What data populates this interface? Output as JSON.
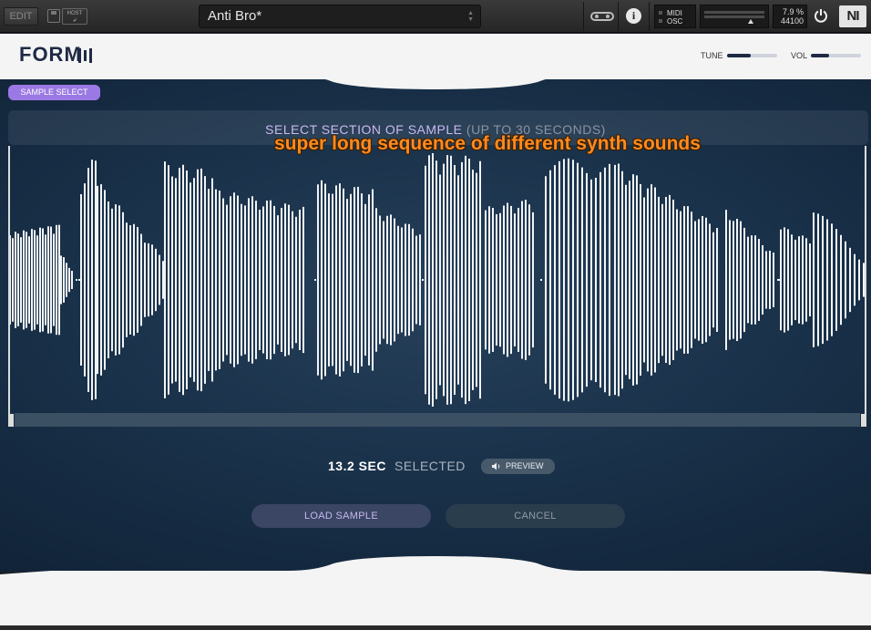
{
  "host": {
    "edit_label": "EDIT",
    "host_button": "HOST",
    "preset_name": "Anti Bro*",
    "midi_label": "MIDI",
    "osc_label": "OSC",
    "cpu_percent": "7.9 %",
    "sample_rate": "44100",
    "ni_logo": "NI"
  },
  "plugin": {
    "logo_text": "FORM",
    "tune_label": "TUNE",
    "tune_level": 0.48,
    "vol_label": "VOL",
    "vol_level": 0.36
  },
  "sample_select": {
    "tab_label": "SAMPLE SELECT",
    "title_highlight": "SELECT SECTION OF SAMPLE",
    "title_dim": "(UP TO 30 SECONDS)",
    "annotation": "super long sequence of different synth sounds",
    "selected_seconds": "13.2 SEC",
    "selected_word": "SELECTED",
    "preview_label": "PREVIEW",
    "load_label": "LOAD SAMPLE",
    "cancel_label": "CANCEL"
  },
  "colors": {
    "accent_purple": "#9b79e4",
    "header_navy": "#1e2a44",
    "panel_blue": "#183048",
    "annotation_orange": "#ff8a1f"
  },
  "icons": {
    "save": "save-icon",
    "loop": "loop-icon",
    "info": "info-icon",
    "power": "power-icon",
    "speaker": "speaker-icon"
  }
}
